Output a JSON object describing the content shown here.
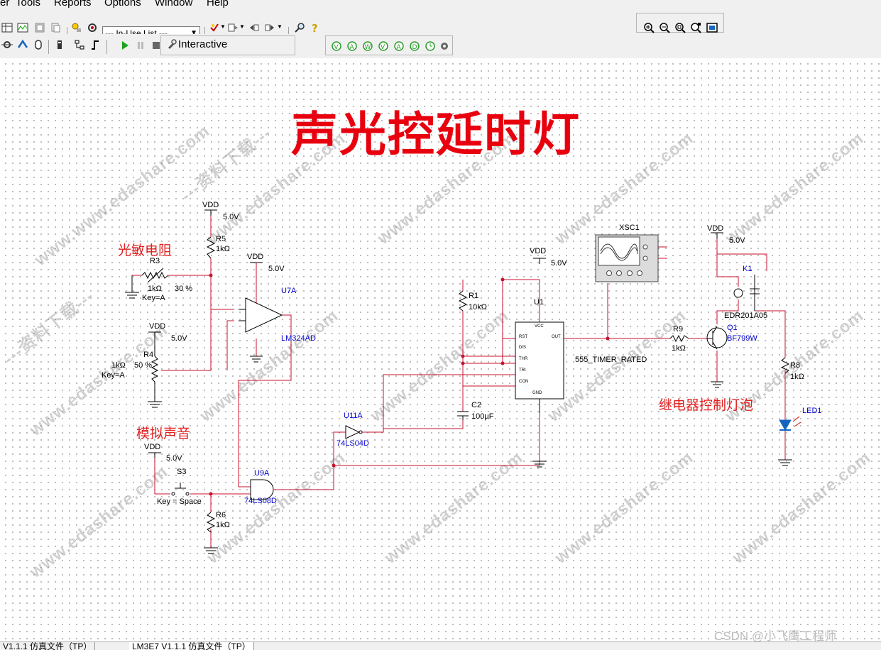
{
  "menubar": {
    "items": [
      "er",
      "Tools",
      "Reports",
      "Options",
      "Window",
      "Help"
    ]
  },
  "toolbar": {
    "inuse_list": "--- In-Use List ---",
    "interactive_label": "Interactive"
  },
  "schematic": {
    "title": "声光控延时灯",
    "annotations": {
      "photoresistor": "光敏电阻",
      "simulated_sound": "模拟声音",
      "relay_control": "继电器控制灯泡"
    },
    "components": {
      "vdd_label": "VDD",
      "vdd_value": "5.0V",
      "r5_ref": "R5",
      "r5_value": "1kΩ",
      "r3_ref": "R3",
      "r3_value": "1kΩ",
      "r3_percent": "30 %",
      "r3_key": "Key=A",
      "r4_ref": "R4",
      "r4_value": "1kΩ",
      "r4_percent": "50 %",
      "r4_key": "Key=A",
      "u7a_ref": "U7A",
      "u7a_part": "LM324AD",
      "s3_ref": "S3",
      "s3_key": "Key = Space",
      "r6_ref": "R6",
      "r6_value": "1kΩ",
      "u9a_ref": "U9A",
      "u9a_part": "74LS08D",
      "u11a_ref": "U11A",
      "u11a_part": "74LS04D",
      "r1_ref": "R1",
      "r1_value": "10kΩ",
      "c2_ref": "C2",
      "c2_value": "100μF",
      "u1_ref": "U1",
      "u1_part": "555_TIMER_RATED",
      "u1_pins": [
        "VCC",
        "RST",
        "OUT",
        "DIS",
        "THR",
        "TRI",
        "CON",
        "GND"
      ],
      "xsc1_ref": "XSC1",
      "r9_ref": "R9",
      "r9_value": "1kΩ",
      "q1_ref": "Q1",
      "q1_part": "BF799W",
      "k1_ref": "K1",
      "k1_part": "EDR201A05",
      "r8_ref": "R8",
      "r8_value": "1kΩ",
      "led1_ref": "LED1"
    },
    "watermark": {
      "site": "www.edashare.com",
      "cn": "---资料下载---"
    },
    "csdn": "CSDN @小飞鹰工程师"
  },
  "statusbar": {
    "tabs": [
      "V1.1.1 仿真文件（TP）",
      "LM3E7 V1.1.1 仿真文件（TP）"
    ]
  }
}
